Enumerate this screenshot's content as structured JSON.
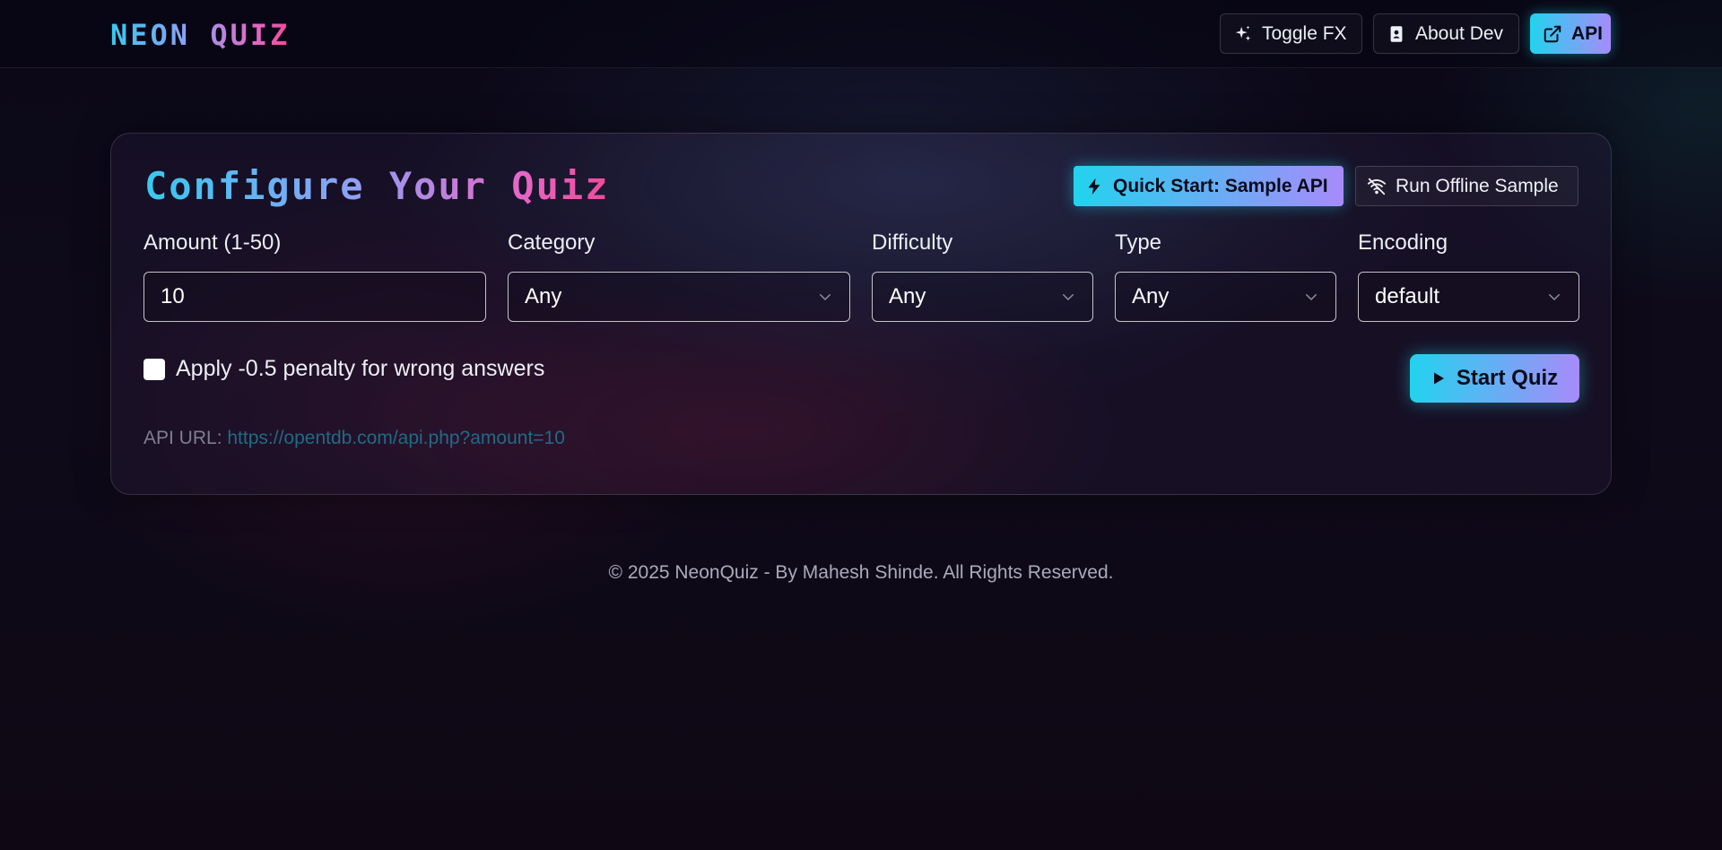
{
  "header": {
    "logo": "NEON QUIZ",
    "toggle_fx_label": "Toggle FX",
    "about_label": "About Dev",
    "api_label": "API"
  },
  "config": {
    "title": "Configure Your Quiz",
    "quick_start_label": "Quick Start: Sample API",
    "offline_label": "Run Offline Sample",
    "fields": {
      "amount": {
        "label": "Amount (1-50)",
        "value": "10"
      },
      "category": {
        "label": "Category",
        "value": "Any"
      },
      "difficulty": {
        "label": "Difficulty",
        "value": "Any"
      },
      "type": {
        "label": "Type",
        "value": "Any"
      },
      "encoding": {
        "label": "Encoding",
        "value": "default"
      }
    },
    "penalty_label": "Apply -0.5 penalty for wrong answers",
    "penalty_checked": false,
    "start_label": "Start Quiz",
    "api_url_prefix": "API URL:",
    "api_url": "https://opentdb.com/api.php?amount=10"
  },
  "footer": {
    "text": "© 2025 NeonQuiz - By Mahesh Shinde. All Rights Reserved."
  },
  "colors": {
    "accent_cyan": "#22d3ee",
    "accent_violet": "#a78bfa",
    "accent_pink": "#f04a9a",
    "background": "#0e0a1a"
  },
  "icons": {
    "toggle_fx": "sparkles-icon",
    "about": "id-badge-icon",
    "api": "external-link-icon",
    "quick_start": "bolt-icon",
    "offline": "wifi-off-icon",
    "select": "chevron-down-icon",
    "start": "play-icon"
  }
}
